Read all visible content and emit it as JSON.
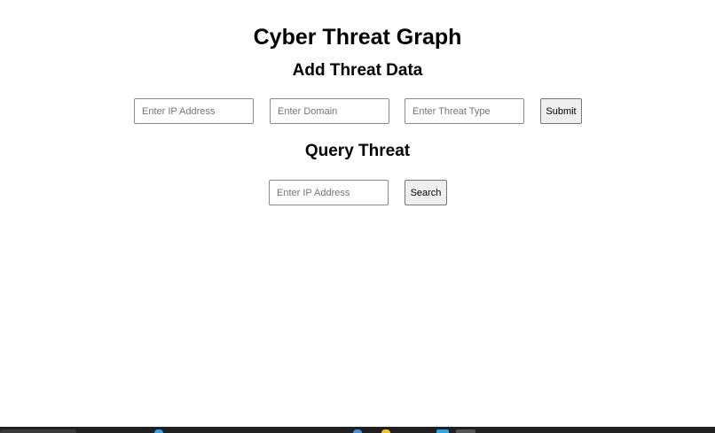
{
  "page": {
    "title": "Cyber Threat Graph"
  },
  "add_section": {
    "heading": "Add Threat Data",
    "ip_placeholder": "Enter IP Address",
    "domain_placeholder": "Enter Domain",
    "threat_type_placeholder": "Enter Threat Type",
    "submit_label": "Submit"
  },
  "query_section": {
    "heading": "Query Threat",
    "ip_placeholder": "Enter IP Address",
    "search_label": "Search"
  },
  "taskbar": {
    "icons": [
      "start-button",
      "app-icon",
      "app-icon",
      "app-icon",
      "app-icon",
      "app-icon"
    ]
  }
}
